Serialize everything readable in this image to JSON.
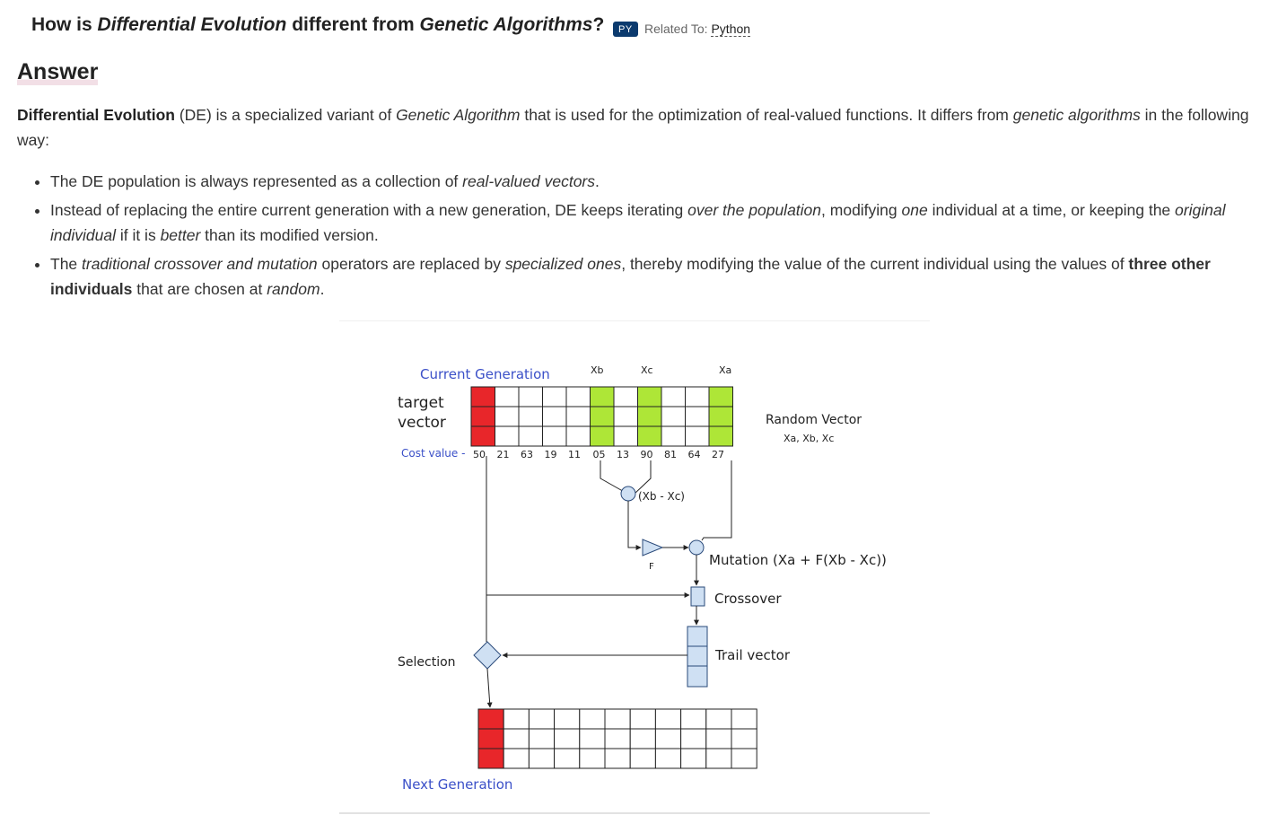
{
  "question": {
    "prefix": "How is",
    "term1": "Differential Evolution",
    "middle": "different from",
    "term2": "Genetic Algorithms",
    "suffix": "?",
    "badge": "PY",
    "related_label": "Related To:",
    "related_link": "Python"
  },
  "answer": {
    "heading": "Answer",
    "intro": {
      "bold": "Differential Evolution",
      "t1": " (DE) is a specialized variant of ",
      "em1": "Genetic Algorithm",
      "t2": " that is used for the optimization of real-valued functions. It differs from ",
      "em2": "genetic algorithms",
      "t3": " in the following way:"
    },
    "bullets": [
      {
        "t1": "The DE population is always represented as a collection of ",
        "em1": "real-valued vectors",
        "t2": "."
      },
      {
        "t1": "Instead of replacing the entire current generation with a new generation, DE keeps iterating ",
        "em1": "over the population",
        "t2": ", modifying ",
        "em2": "one",
        "t3": " individual at a time, or keeping the ",
        "em3": "original individual",
        "t4": " if it is ",
        "em4": "better",
        "t5": " than its modified version."
      },
      {
        "t1": "The ",
        "em1": "traditional crossover and mutation",
        "t2": " operators are replaced by ",
        "em2": "specialized ones",
        "t3": ", thereby modifying the value of the current individual using the values of ",
        "b1": "three other individuals",
        "t4": " that are chosen at ",
        "em3": "random",
        "t5": "."
      }
    ]
  },
  "diagram": {
    "current_generation": "Current Generation",
    "target_vector_line1": "target",
    "target_vector_line2": "vector",
    "xb": "Xb",
    "xc": "Xc",
    "xa": "Xa",
    "random_vector": "Random Vector",
    "random_vector_sub": "Xa, Xb, Xc",
    "cost_value_label": "Cost value -",
    "cost_values": [
      "50",
      "21",
      "63",
      "19",
      "11",
      "05",
      "13",
      "90",
      "81",
      "64",
      "27"
    ],
    "difference": "(Xb - Xc)",
    "f_label": "F",
    "mutation": "Mutation (Xa + F(Xb - Xc))",
    "crossover": "Crossover",
    "trail_vector": "Trail vector",
    "selection": "Selection",
    "next_generation": "Next Generation",
    "colors": {
      "target": "#e8262a",
      "random": "#aee637",
      "node": "#cfe0f3",
      "blue_text": "#3b50c8"
    }
  }
}
